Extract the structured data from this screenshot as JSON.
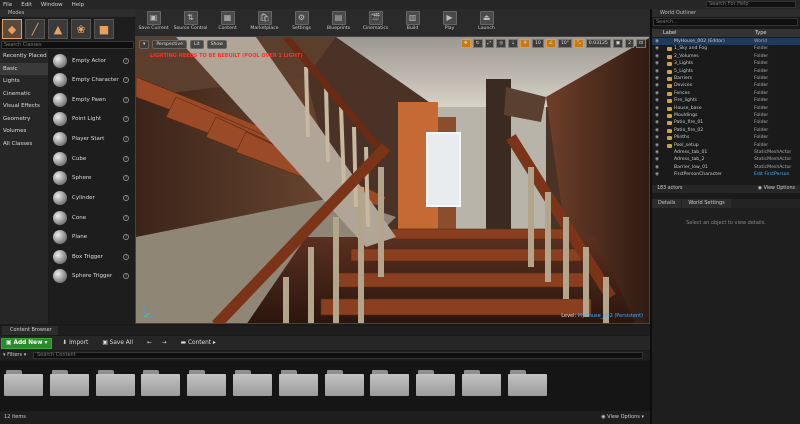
{
  "menu": [
    "File",
    "Edit",
    "Window",
    "Help"
  ],
  "search_help": "Search For Help",
  "modes": {
    "tab_label": "Modes",
    "search_placeholder": "Search Classes",
    "categories": [
      "Recently Placed",
      "Basic",
      "Lights",
      "Cinematic",
      "Visual Effects",
      "Geometry",
      "Volumes",
      "All Classes"
    ],
    "selected_category": "Basic",
    "items": [
      "Empty Actor",
      "Empty Character",
      "Empty Pawn",
      "Point Light",
      "Player Start",
      "Cube",
      "Sphere",
      "Cylinder",
      "Cone",
      "Plane",
      "Box Trigger",
      "Sphere Trigger"
    ]
  },
  "toolbar": [
    "Save Current",
    "Source Control",
    "Content",
    "Marketplace",
    "Settings",
    "Blueprints",
    "Cinematics",
    "Build",
    "Play",
    "Launch"
  ],
  "viewport": {
    "perspective": "Perspective",
    "lit": "Lit",
    "show": "Show",
    "snap_value": "10",
    "angle_value": "10°",
    "scale_value": "0.03125",
    "camera_speed": "2",
    "grid_count": "5",
    "warning": "LIGHTING NEEDS TO BE REBUILT  (POOL OVER 1 LIGHT)",
    "level_label": "Level:",
    "level_name": "MyHouse_002 (Persistent)"
  },
  "outliner": {
    "tab_label": "World Outliner",
    "search_placeholder": "Search...",
    "col_label": "Label",
    "col_type": "Type",
    "rows": [
      {
        "name": "MyHouse_002 (Editor)",
        "type": "World"
      },
      {
        "name": "1_Sky and Fog",
        "type": "Folder"
      },
      {
        "name": "2_Volumes",
        "type": "Folder"
      },
      {
        "name": "3_Lights",
        "type": "Folder"
      },
      {
        "name": "5_Lights",
        "type": "Folder"
      },
      {
        "name": "Barriers",
        "type": "Folder"
      },
      {
        "name": "Devices",
        "type": "Folder"
      },
      {
        "name": "Fences",
        "type": "Folder"
      },
      {
        "name": "Fire_lights",
        "type": "Folder"
      },
      {
        "name": "House_base",
        "type": "Folder"
      },
      {
        "name": "Mouldings",
        "type": "Folder"
      },
      {
        "name": "Patio_fire_01",
        "type": "Folder"
      },
      {
        "name": "Patio_fire_02",
        "type": "Folder"
      },
      {
        "name": "Plinths",
        "type": "Folder"
      },
      {
        "name": "Pool_setup",
        "type": "Folder"
      },
      {
        "name": "Adress_tab_01",
        "type": "StaticMeshActor"
      },
      {
        "name": "Adress_tab_2",
        "type": "StaticMeshActor"
      },
      {
        "name": "Barrier_low_01",
        "type": "StaticMeshActor"
      },
      {
        "name": "FirstPersonCharacter",
        "type": "Edit FirstPerson"
      }
    ],
    "actor_count": "183 actors",
    "view_options": "View Options"
  },
  "details": {
    "tab_details": "Details",
    "tab_world_settings": "World Settings",
    "message": "Select an object to view details."
  },
  "content_browser": {
    "tab_label": "Content Browser",
    "add_new": "Add New",
    "import": "Import",
    "save_all": "Save All",
    "path": "Content",
    "filters": "Filters",
    "search_placeholder": "Search Content",
    "folder_count": 12,
    "item_count": "12 items",
    "view_options": "View Options"
  }
}
